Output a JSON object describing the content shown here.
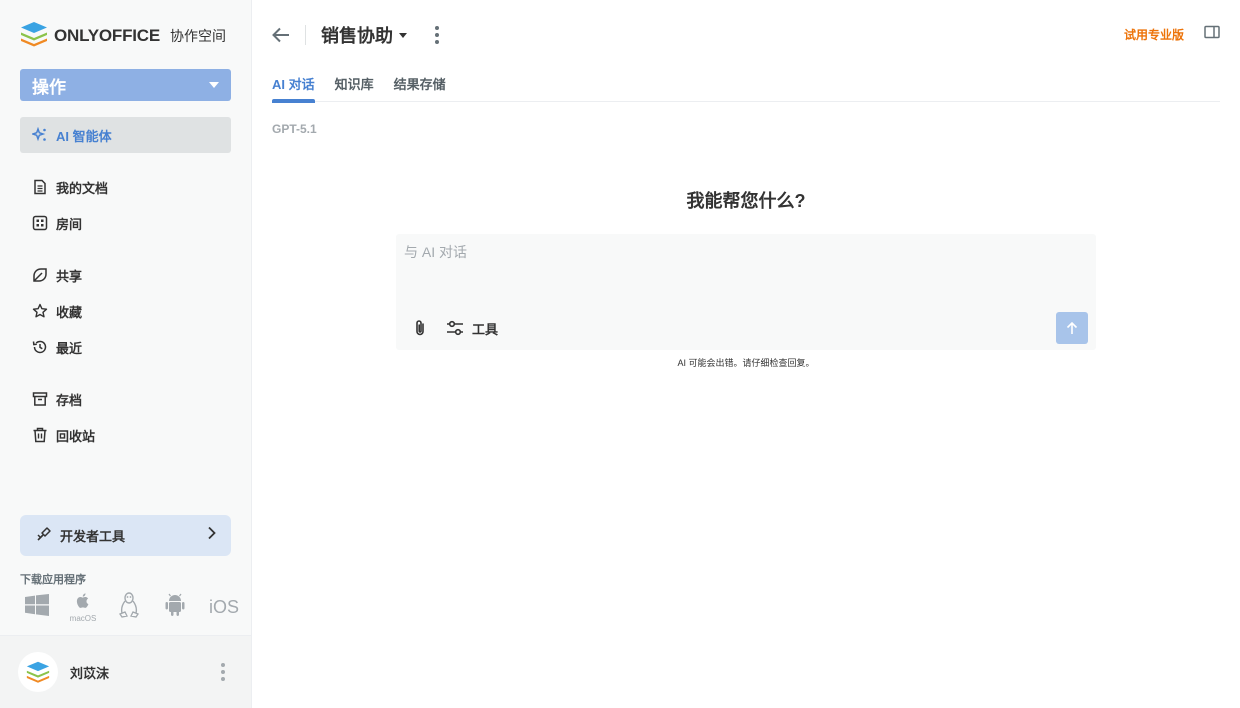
{
  "sidebar": {
    "logo": {
      "brand": "ONLYOFFICE",
      "sub": "协作空间"
    },
    "action_label": "操作",
    "items": [
      {
        "label": "AI 智能体",
        "icon": "ai-sparkle-icon",
        "active": true
      },
      {
        "label": "我的文档",
        "icon": "document-icon"
      },
      {
        "label": "房间",
        "icon": "rooms-icon"
      },
      {
        "label": "共享",
        "icon": "share-icon"
      },
      {
        "label": "收藏",
        "icon": "star-icon"
      },
      {
        "label": "最近",
        "icon": "history-icon"
      },
      {
        "label": "存档",
        "icon": "archive-icon"
      },
      {
        "label": "回收站",
        "icon": "trash-icon"
      }
    ],
    "dev_tools_label": "开发者工具",
    "download_title": "下载应用程序",
    "apps": {
      "macos_label": "macOS",
      "ios_label": "iOS"
    },
    "user": {
      "name": "刘苡沫"
    }
  },
  "header": {
    "title": "销售协助",
    "try_pro": "试用专业版"
  },
  "tabs": [
    {
      "label": "AI 对话",
      "active": true
    },
    {
      "label": "知识库"
    },
    {
      "label": "结果存储"
    }
  ],
  "chat": {
    "model": "GPT-5.1",
    "hero": "我能帮您什么?",
    "placeholder": "与 AI 对话",
    "tools_label": "工具",
    "disclaimer": "AI 可能会出错。请仔细检查回复。"
  },
  "colors": {
    "accent": "#4781d1",
    "action_button": "#8eb0e4",
    "pro": "#ed7309",
    "send_button": "#a8c4ea"
  }
}
